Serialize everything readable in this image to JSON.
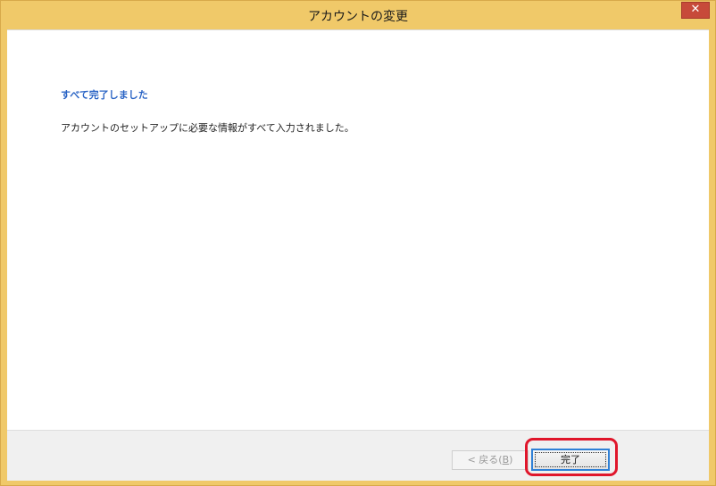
{
  "window": {
    "title": "アカウントの変更",
    "close_label": "✕"
  },
  "content": {
    "heading": "すべて完了しました",
    "message": "アカウントのセットアップに必要な情報がすべて入力されました。"
  },
  "footer": {
    "back_label_prefix": "< 戻る(",
    "back_mnemonic": "B",
    "back_label_suffix": ")",
    "finish_label": "完了"
  },
  "colors": {
    "frame": "#f0c969",
    "heading": "#2a64c5",
    "highlight": "#e0162b",
    "close": "#c74a3a"
  }
}
